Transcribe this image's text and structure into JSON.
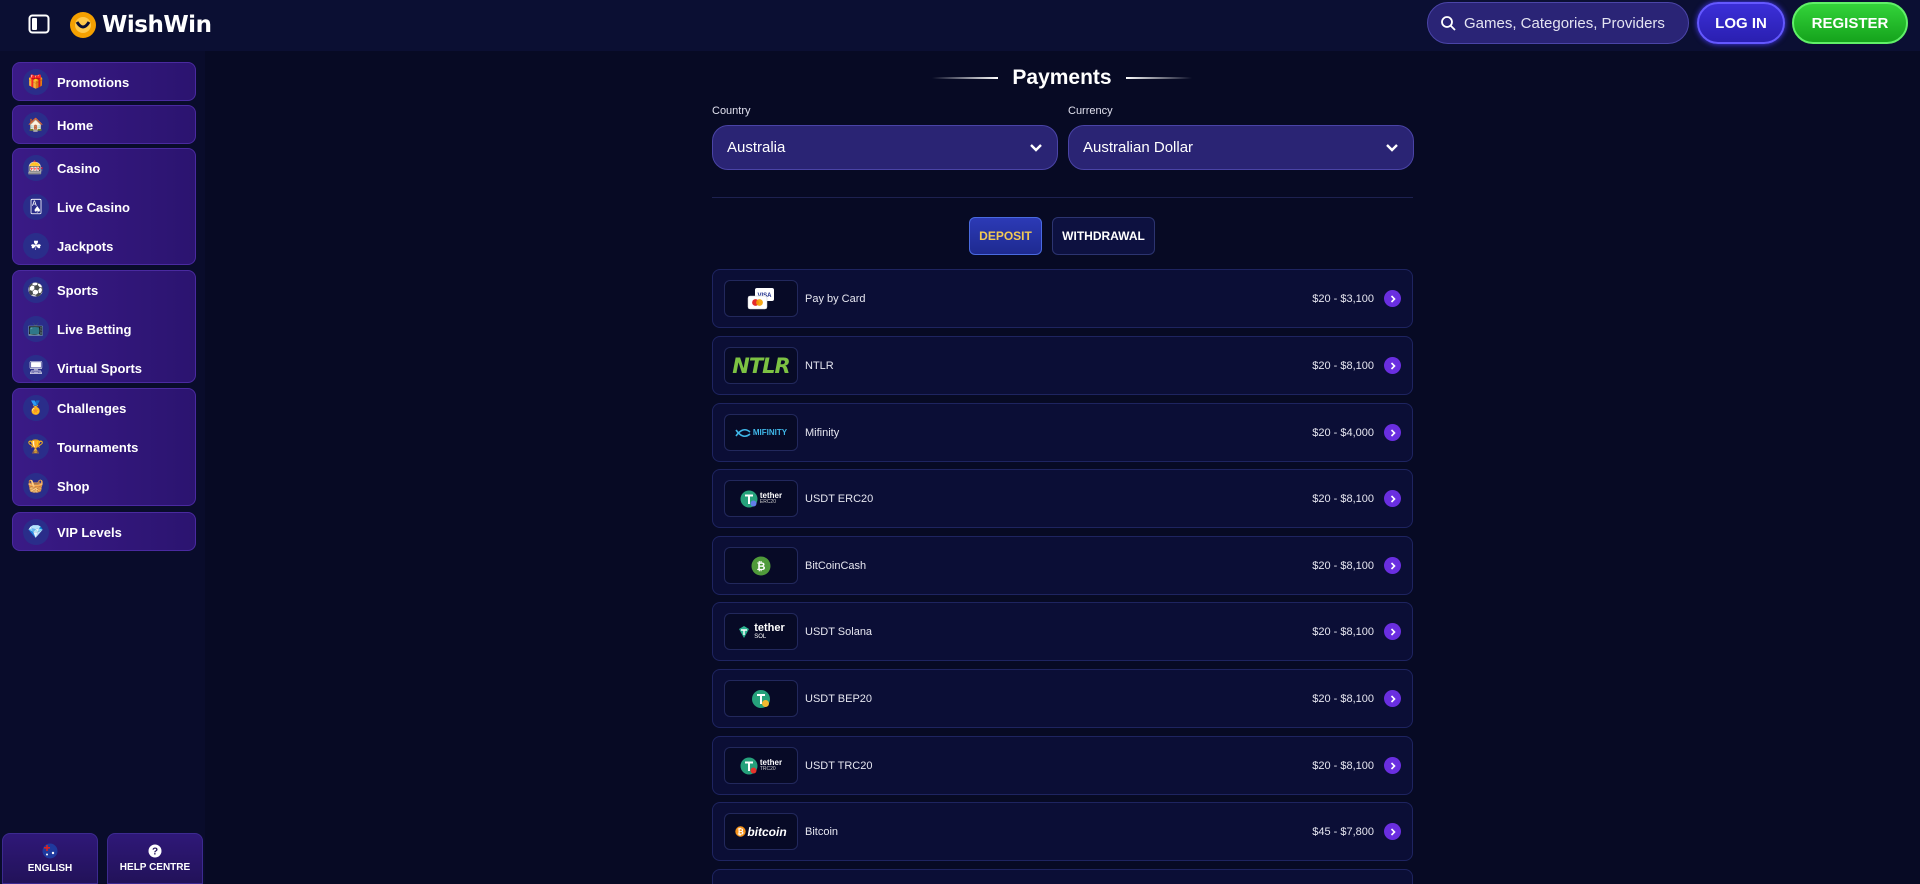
{
  "header": {
    "brand": "WishWin",
    "search_placeholder": "Games, Categories, Providers",
    "login_label": "LOG IN",
    "register_label": "REGISTER"
  },
  "sidebar": {
    "groups": [
      {
        "items": [
          {
            "label": "Promotions",
            "icon": "gift-icon"
          }
        ]
      },
      {
        "items": [
          {
            "label": "Home",
            "icon": "home-icon"
          }
        ]
      },
      {
        "items": [
          {
            "label": "Casino",
            "icon": "slot-machine-icon"
          },
          {
            "label": "Live Casino",
            "icon": "playing-card-icon"
          },
          {
            "label": "Jackpots",
            "icon": "clover-icon"
          }
        ]
      },
      {
        "items": [
          {
            "label": "Sports",
            "icon": "ball-icon"
          },
          {
            "label": "Live Betting",
            "icon": "live-icon"
          },
          {
            "label": "Virtual Sports",
            "icon": "monitor-icon"
          }
        ]
      },
      {
        "items": [
          {
            "label": "Challenges",
            "icon": "medal-icon"
          },
          {
            "label": "Tournaments",
            "icon": "trophy-icon"
          },
          {
            "label": "Shop",
            "icon": "basket-icon"
          }
        ]
      },
      {
        "items": [
          {
            "label": "VIP Levels",
            "icon": "diamond-icon"
          }
        ]
      }
    ],
    "language_label": "ENGLISH",
    "help_label": "HELP CENTRE"
  },
  "main": {
    "title": "Payments",
    "country": {
      "label": "Country",
      "value": "Australia"
    },
    "currency": {
      "label": "Currency",
      "value": "Australian Dollar"
    },
    "tabs": [
      {
        "label": "DEPOSIT",
        "active": true
      },
      {
        "label": "WITHDRAWAL",
        "active": false
      }
    ],
    "methods": [
      {
        "name": "Pay by Card",
        "range": "$20 - $3,100",
        "logo": "card-logo"
      },
      {
        "name": "NTLR",
        "range": "$20 - $8,100",
        "logo": "ntlr-logo",
        "logo_text": "NTLR"
      },
      {
        "name": "Mifinity",
        "range": "$20 - $4,000",
        "logo": "mifinity-logo",
        "logo_text": "MIFINITY"
      },
      {
        "name": "USDT ERC20",
        "range": "$20 - $8,100",
        "logo": "tether-erc20-logo",
        "logo_text": "tether",
        "logo_sub": "ERC20"
      },
      {
        "name": "BitCoinCash",
        "range": "$20 - $8,100",
        "logo": "bitcoincash-logo"
      },
      {
        "name": "USDT Solana",
        "range": "$20 - $8,100",
        "logo": "tether-sol-logo",
        "logo_text": "tether",
        "logo_sub": "SOL"
      },
      {
        "name": "USDT BEP20",
        "range": "$20 - $8,100",
        "logo": "tether-bep20-logo"
      },
      {
        "name": "USDT TRC20",
        "range": "$20 - $8,100",
        "logo": "tether-trc20-logo",
        "logo_text": "tether",
        "logo_sub": "TRC20"
      },
      {
        "name": "Bitcoin",
        "range": "$45 - $7,800",
        "logo": "bitcoin-logo",
        "logo_text": "bitcoin"
      }
    ]
  },
  "colors": {
    "background": "#070a24",
    "accent": "#6a2ee0",
    "register": "#22c22a",
    "login": "#3b2fd8",
    "deposit_text": "#f2c955"
  }
}
